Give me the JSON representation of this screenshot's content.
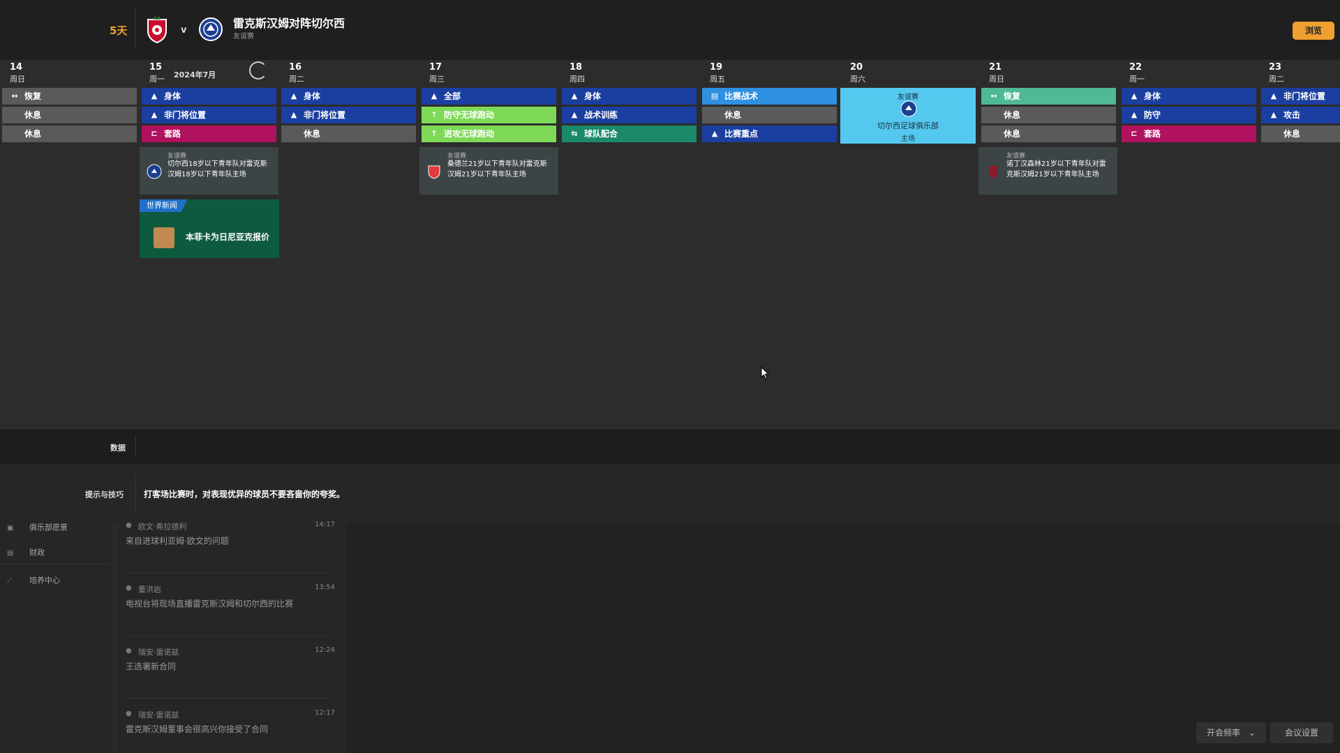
{
  "header": {
    "days_label": "5天",
    "vs": "v",
    "match_title": "雷克斯汉姆对阵切尔西",
    "match_subtitle": "友谊赛",
    "browse_button": "浏览"
  },
  "calendar": {
    "month_label": "2024年7月",
    "days": [
      {
        "num": "14",
        "weekday": "周日",
        "sessions": [
          {
            "label": "恢复",
            "icon": "recovery-icon",
            "color": "#5a5a5a"
          },
          {
            "label": "休息",
            "icon": "",
            "color": "#5a5a5a"
          },
          {
            "label": "休息",
            "icon": "",
            "color": "#5a5a5a"
          }
        ]
      },
      {
        "num": "15",
        "weekday": "周一",
        "sessions": [
          {
            "label": "身体",
            "icon": "physical-icon",
            "color": "#1a3fa0"
          },
          {
            "label": "非门将位置",
            "icon": "physical-icon",
            "color": "#1a3fa0"
          },
          {
            "label": "套路",
            "icon": "set-piece-icon",
            "color": "#b1125f"
          }
        ]
      },
      {
        "num": "16",
        "weekday": "周二",
        "sessions": [
          {
            "label": "身体",
            "icon": "physical-icon",
            "color": "#1a3fa0"
          },
          {
            "label": "非门将位置",
            "icon": "physical-icon",
            "color": "#1a3fa0"
          },
          {
            "label": "休息",
            "icon": "",
            "color": "#5a5a5a"
          }
        ]
      },
      {
        "num": "17",
        "weekday": "周三",
        "sessions": [
          {
            "label": "全部",
            "icon": "physical-icon",
            "color": "#1a3fa0"
          },
          {
            "label": "防守无球跑动",
            "icon": "movement-icon",
            "color": "#7ed957"
          },
          {
            "label": "进攻无球跑动",
            "icon": "movement-icon",
            "color": "#7ed957"
          }
        ]
      },
      {
        "num": "18",
        "weekday": "周四",
        "sessions": [
          {
            "label": "身体",
            "icon": "physical-icon",
            "color": "#1a3fa0"
          },
          {
            "label": "战术训练",
            "icon": "physical-icon",
            "color": "#1a3fa0"
          },
          {
            "label": "球队配合",
            "icon": "team-icon",
            "color": "#1c8a6a"
          }
        ]
      },
      {
        "num": "19",
        "weekday": "周五",
        "sessions": [
          {
            "label": "比赛战术",
            "icon": "tactics-icon",
            "color": "#2f8fe0"
          },
          {
            "label": "休息",
            "icon": "",
            "color": "#5a5a5a"
          },
          {
            "label": "比赛重点",
            "icon": "physical-icon",
            "color": "#1a3fa0"
          }
        ]
      },
      {
        "num": "20",
        "weekday": "周六",
        "sessions": []
      },
      {
        "num": "21",
        "weekday": "周日",
        "sessions": [
          {
            "label": "恢复",
            "icon": "recovery-icon",
            "color": "#4fb896"
          },
          {
            "label": "休息",
            "icon": "",
            "color": "#5a5a5a"
          },
          {
            "label": "休息",
            "icon": "",
            "color": "#5a5a5a"
          }
        ]
      },
      {
        "num": "22",
        "weekday": "周一",
        "sessions": [
          {
            "label": "身体",
            "icon": "physical-icon",
            "color": "#1a3fa0"
          },
          {
            "label": "防守",
            "icon": "physical-icon",
            "color": "#1a3fa0"
          },
          {
            "label": "套路",
            "icon": "set-piece-icon",
            "color": "#b1125f"
          }
        ]
      },
      {
        "num": "23",
        "weekday": "周二",
        "sessions": [
          {
            "label": "非门将位置",
            "icon": "physical-icon",
            "color": "#1a3fa0"
          },
          {
            "label": "攻击",
            "icon": "physical-icon",
            "color": "#1a3fa0"
          },
          {
            "label": "休息",
            "icon": "",
            "color": "#5a5a5a"
          }
        ]
      }
    ],
    "fixtures": [
      {
        "type": "友谊赛",
        "text": "切尔西18岁以下青年队对雷克斯汉姆18岁以下青年队主场"
      },
      {
        "type": "友谊赛",
        "text": "桑德兰21岁以下青年队对雷克斯汉姆21岁以下青年队主场"
      },
      {
        "type": "友谊赛",
        "text": "诺丁汉森林21岁以下青年队对雷克斯汉姆21岁以下青年队主场"
      }
    ],
    "match": {
      "type": "友谊赛",
      "opponent": "切尔西足球俱乐部",
      "venue": "主场"
    },
    "news": {
      "tag": "世界新闻",
      "headline": "本菲卡为日尼亚克报价"
    }
  },
  "data_bar": {
    "label": "数据"
  },
  "tips": {
    "label": "提示与技巧",
    "text": "打客场比赛时，对表现优异的球员不要吝啬你的夸奖。"
  },
  "sidebar": {
    "items": [
      {
        "label": "俱乐部愿景",
        "icon": "vision-icon"
      },
      {
        "label": "财政",
        "icon": "finance-icon"
      },
      {
        "label": "培养中心",
        "icon": "development-icon"
      }
    ]
  },
  "inbox": {
    "messages": [
      {
        "sender": "欧文·希拉德利",
        "time": "14:17",
        "body": "来自进球利亚姆·欧文的问题"
      },
      {
        "sender": "董洪岩",
        "time": "13:54",
        "body": "电视台将现场直播雷克斯汉姆和切尔西的比赛"
      },
      {
        "sender": "瑞安·雷诺兹",
        "time": "12:24",
        "body": "王选署新合同"
      },
      {
        "sender": "瑞安·雷诺兹",
        "time": "12:17",
        "body": "雷克斯汉姆董事会很高兴你接受了合同"
      }
    ]
  },
  "bottom": {
    "meeting_freq": "开会频率",
    "meeting_settings": "会议设置"
  }
}
